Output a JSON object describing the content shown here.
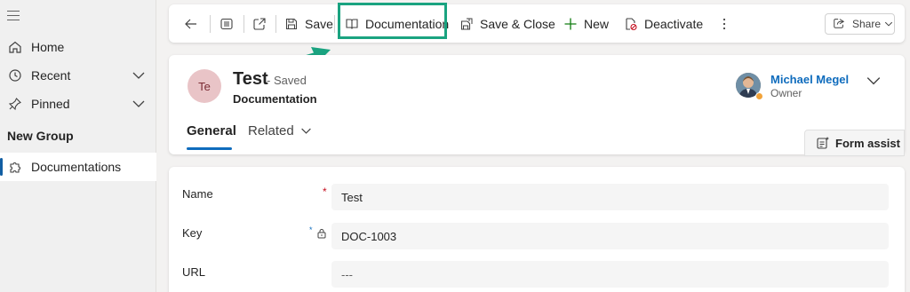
{
  "sidebar": {
    "items": [
      {
        "label": "Home",
        "icon": "home-icon"
      },
      {
        "label": "Recent",
        "icon": "clock-icon"
      },
      {
        "label": "Pinned",
        "icon": "pin-icon"
      }
    ],
    "group_title": "New Group",
    "group_items": [
      {
        "label": "Documentations",
        "icon": "puzzle-icon",
        "selected": true
      }
    ]
  },
  "toolbar": {
    "save_label": "Save",
    "documentation_label": "Documentation",
    "save_close_label": "Save & Close",
    "new_label": "New",
    "deactivate_label": "Deactivate",
    "share_label": "Share",
    "highlight_color": "#1aa380"
  },
  "header": {
    "avatar_initials": "Te",
    "title": "Test",
    "saved_status": "- Saved",
    "entity": "Documentation",
    "owner_name": "Michael Megel",
    "owner_role": "Owner",
    "tabs": [
      {
        "label": "General",
        "active": true
      },
      {
        "label": "Related",
        "active": false
      }
    ],
    "form_assist_label": "Form assist"
  },
  "form": {
    "fields": [
      {
        "label": "Name",
        "value": "Test",
        "required": true
      },
      {
        "label": "Key",
        "value": "DOC-1003",
        "recommended": true,
        "locked": true
      },
      {
        "label": "URL",
        "value": "---",
        "required": false
      }
    ]
  }
}
